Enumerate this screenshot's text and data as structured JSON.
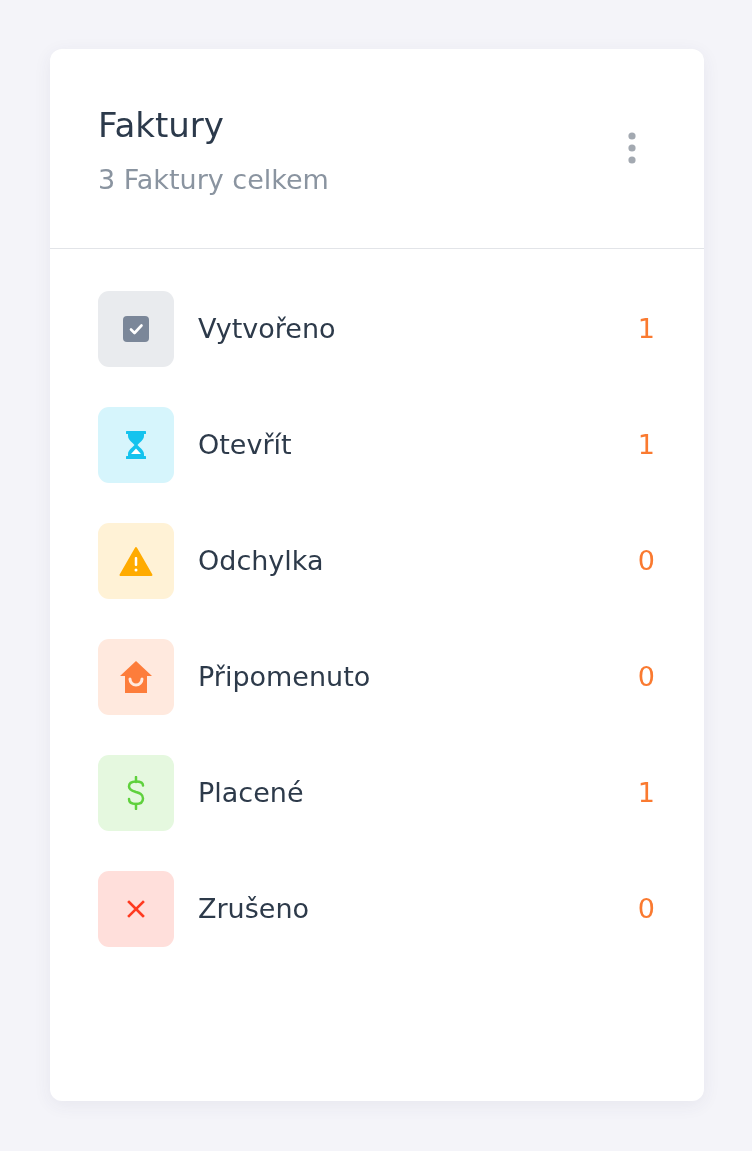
{
  "card": {
    "title": "Faktury",
    "subtitle": "3 Faktury celkem"
  },
  "items": [
    {
      "kind": "created",
      "label": "Vytvořeno",
      "count": "1"
    },
    {
      "kind": "open",
      "label": "Otevřít",
      "count": "1"
    },
    {
      "kind": "deviation",
      "label": "Odchylka",
      "count": "0"
    },
    {
      "kind": "reminded",
      "label": "Připomenuto",
      "count": "0"
    },
    {
      "kind": "paid",
      "label": "Placené",
      "count": "1"
    },
    {
      "kind": "cancelled",
      "label": "Zrušeno",
      "count": "0"
    }
  ]
}
